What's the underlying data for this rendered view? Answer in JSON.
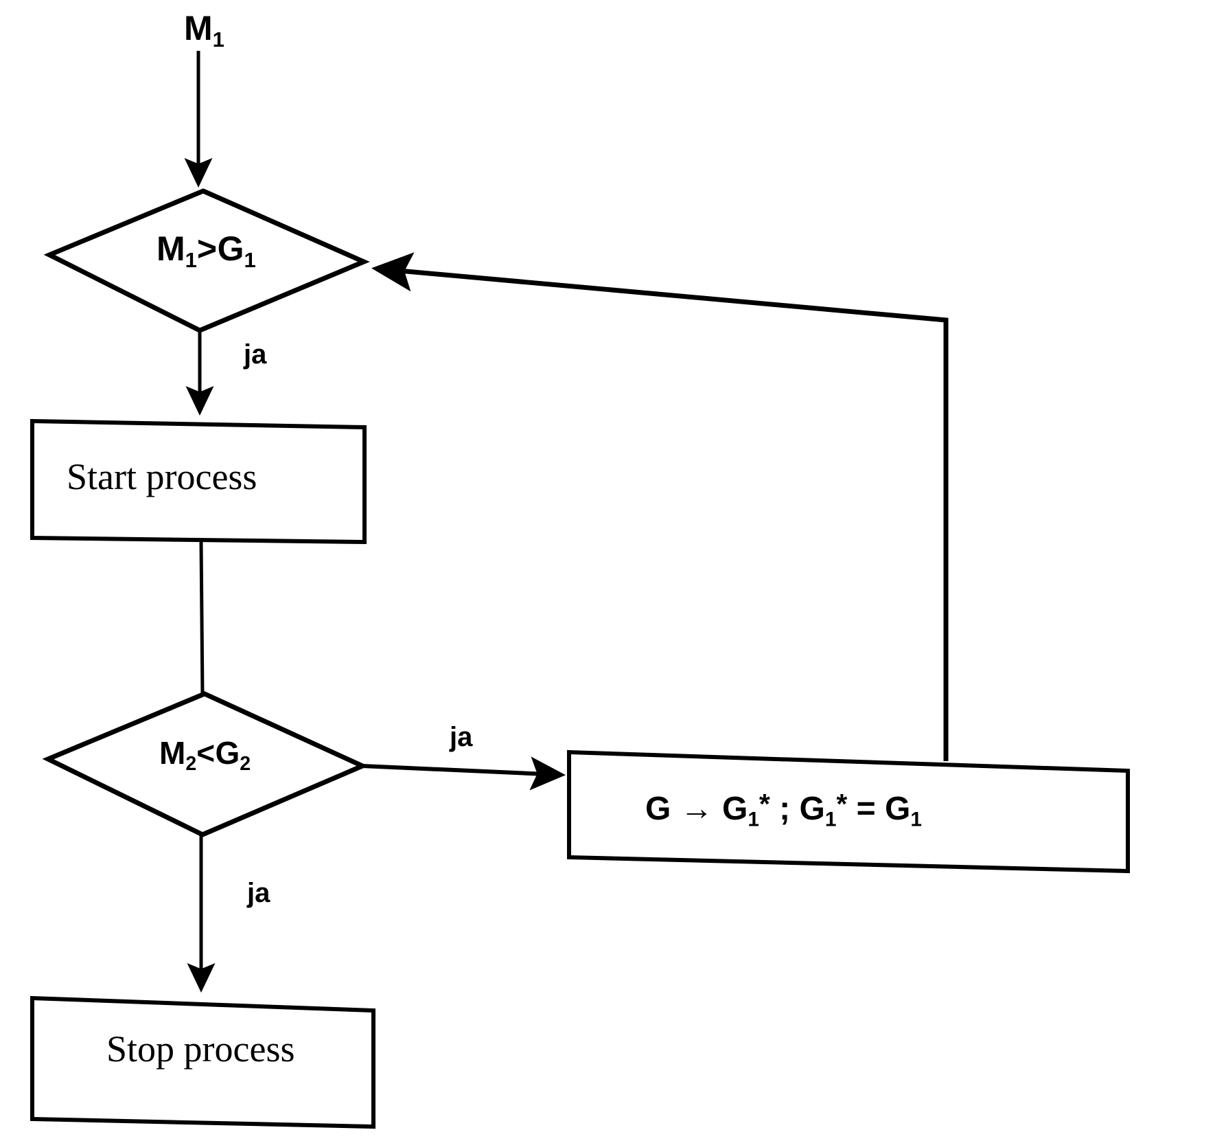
{
  "diagram": {
    "type": "flowchart",
    "language": "de",
    "background_color": "#ffffff",
    "line_color": "#000000",
    "input_label": "M1",
    "nodes": [
      {
        "id": "input",
        "shape": "label",
        "text": "M",
        "subscript": "1",
        "full_text": "M1"
      },
      {
        "id": "decision1",
        "shape": "diamond",
        "lhs": "M",
        "lhs_sub": "1",
        "operator": ">",
        "rhs": "G",
        "rhs_sub": "1",
        "full_text": "M1>G1"
      },
      {
        "id": "start-process",
        "shape": "rectangle",
        "text": "Start process"
      },
      {
        "id": "decision2",
        "shape": "diamond",
        "lhs": "M",
        "lhs_sub": "2",
        "operator": "<",
        "rhs": "G",
        "rhs_sub": "2",
        "full_text": "M2<G2"
      },
      {
        "id": "assign",
        "shape": "rectangle",
        "part1": "G",
        "arrow": "→",
        "part2": "G",
        "part2_sub": "1",
        "part2_star": "*",
        "separator": ";",
        "part3": "G",
        "part3_sub": "1",
        "part3_star": "*",
        "equals": "=",
        "part4": "G",
        "part4_sub": "1",
        "full_text": "G → G1* ; G1* = G1"
      },
      {
        "id": "stop-process",
        "shape": "rectangle",
        "text": "Stop process"
      }
    ],
    "edges": [
      {
        "id": "input-to-decision1",
        "label": "",
        "from": "input",
        "to": "decision1",
        "arrow": true
      },
      {
        "id": "decision1-yes",
        "label": "ja",
        "from": "decision1",
        "to": "start-process",
        "arrow": true
      },
      {
        "id": "start-to-decision2",
        "label": "",
        "from": "start-process",
        "to": "decision2",
        "arrow": false
      },
      {
        "id": "decision2-yes-right",
        "label": "ja",
        "from": "decision2",
        "to": "assign",
        "arrow": true
      },
      {
        "id": "decision2-yes-down",
        "label": "ja",
        "from": "decision2",
        "to": "stop-process",
        "arrow": true
      },
      {
        "id": "assign-feedback",
        "label": "",
        "from": "assign",
        "to": "decision1",
        "arrow": true
      }
    ],
    "edge_labels": {
      "decision1_yes": "ja",
      "decision2_right": "ja",
      "decision2_down": "ja"
    }
  }
}
